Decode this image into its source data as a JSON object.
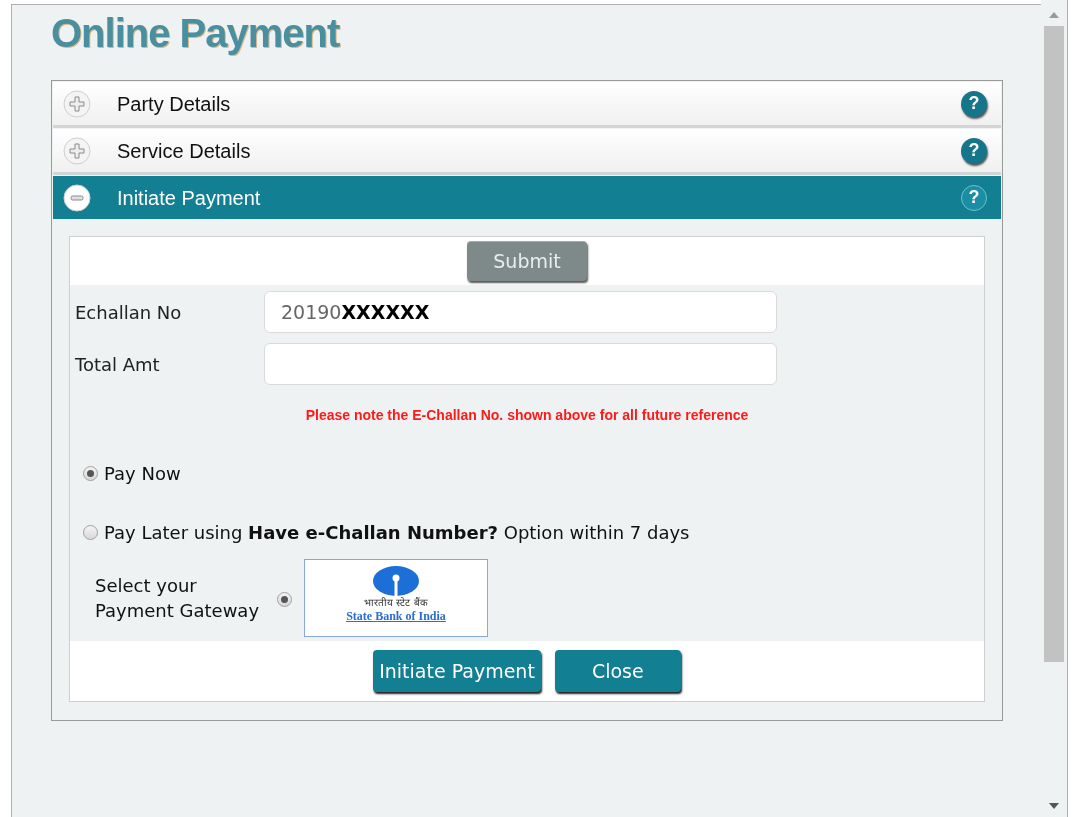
{
  "title": "Online Payment",
  "sections": [
    {
      "label": "Party Details",
      "expanded": false,
      "help": "?"
    },
    {
      "label": "Service Details",
      "expanded": false,
      "help": "?"
    },
    {
      "label": "Initiate Payment",
      "expanded": true,
      "help": "?"
    }
  ],
  "submit_button": "Submit",
  "fields": [
    {
      "label": "Echallan No",
      "value": "20190**XXXXXX**"
    },
    {
      "label": "Total Amt"
    }
  ],
  "note": "Please note the E-Challan No. shown above for all future reference",
  "pay_options": [
    {
      "label": "Pay Now",
      "selected": true
    },
    {
      "label": "Pay Later using **Have e-Challan Number?** Option within 7 days",
      "selected": false
    }
  ],
  "gateway": {
    "label": "Select your Payment Gateway",
    "selected": true,
    "logo_hindi": "भारतीय स्टेट बैंक",
    "logo_name": "State Bank of India"
  },
  "buttons": [
    "Initiate Payment",
    "Close"
  ]
}
